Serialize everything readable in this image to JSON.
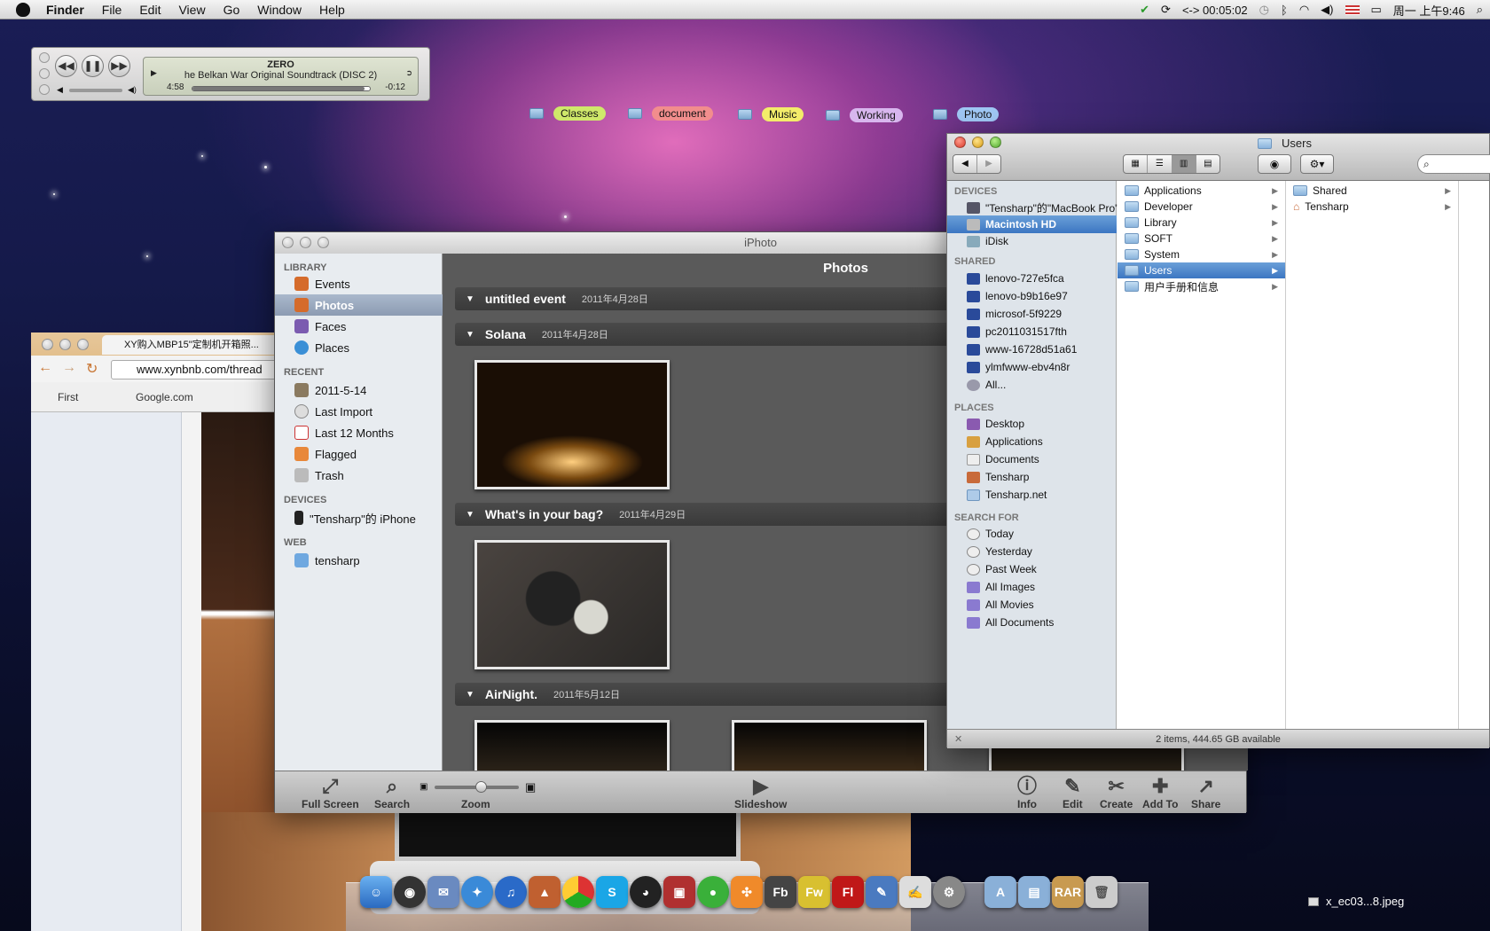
{
  "menubar": {
    "app": "Finder",
    "items": [
      "File",
      "Edit",
      "View",
      "Go",
      "Window",
      "Help"
    ],
    "timer": "<-> 00:05:02",
    "clock": "周一 上午9:46"
  },
  "itunes": {
    "title": "ZERO",
    "album": "he Belkan War Original Soundtrack (DISC 2)",
    "elapsed": "4:58",
    "remaining": "-0:12",
    "progress": 0.97
  },
  "desktop_folders": [
    {
      "label": "Classes",
      "color": "#cfe86a"
    },
    {
      "label": "document",
      "color": "#f28d8d"
    },
    {
      "label": "Music",
      "color": "#f3ec6a"
    },
    {
      "label": "Working",
      "color": "#d8b6ee"
    },
    {
      "label": "Photo",
      "color": "#9fc7f4"
    }
  ],
  "browser": {
    "tab": "XY购入MBP15\"定制机开箱照...",
    "url": "www.xynbnb.com/thread",
    "bookmarks": [
      "First",
      "Google.com"
    ]
  },
  "iphoto": {
    "title": "iPhoto",
    "main_title": "Photos",
    "library_header": "LIBRARY",
    "library": [
      "Events",
      "Photos",
      "Faces",
      "Places"
    ],
    "recent_header": "RECENT",
    "recent": [
      "2011-5-14",
      "Last Import",
      "Last 12 Months",
      "Flagged",
      "Trash"
    ],
    "devices_header": "DEVICES",
    "devices": [
      "\"Tensharp\"的 iPhone"
    ],
    "web_header": "WEB",
    "web": [
      "tensharp"
    ],
    "events": [
      {
        "name": "untitled event",
        "date": "2011年4月28日"
      },
      {
        "name": "Solana",
        "date": "2011年4月28日"
      },
      {
        "name": "What's in your bag?",
        "date": "2011年4月29日"
      },
      {
        "name": "AirNight.",
        "date": "2011年5月12日"
      }
    ],
    "toolbar": {
      "fullscreen": "Full Screen",
      "search": "Search",
      "zoom": "Zoom",
      "slideshow": "Slideshow",
      "info": "Info",
      "edit": "Edit",
      "create": "Create",
      "addto": "Add To",
      "share": "Share"
    },
    "zoom_level": 0.55
  },
  "finder": {
    "title": "Users",
    "devices_header": "DEVICES",
    "devices": [
      "\"Tensharp\"的\"MacBook Pro\"",
      "Macintosh HD",
      "iDisk"
    ],
    "shared_header": "SHARED",
    "shared": [
      "lenovo-727e5fca",
      "lenovo-b9b16e97",
      "microsof-5f9229",
      "pc2011031517fth",
      "www-16728d51a61",
      "ylmfwww-ebv4n8r",
      "All..."
    ],
    "places_header": "PLACES",
    "places": [
      "Desktop",
      "Applications",
      "Documents",
      "Tensharp",
      "Tensharp.net"
    ],
    "search_header": "SEARCH FOR",
    "search": [
      "Today",
      "Yesterday",
      "Past Week",
      "All Images",
      "All Movies",
      "All Documents"
    ],
    "col1": [
      "Applications",
      "Developer",
      "Library",
      "SOFT",
      "System",
      "Users",
      "用户手册和信息"
    ],
    "col2": [
      "Shared",
      "Tensharp"
    ],
    "status": "2 items, 444.65 GB available"
  },
  "dock": {
    "file": "x_ec03...8.jpeg"
  }
}
